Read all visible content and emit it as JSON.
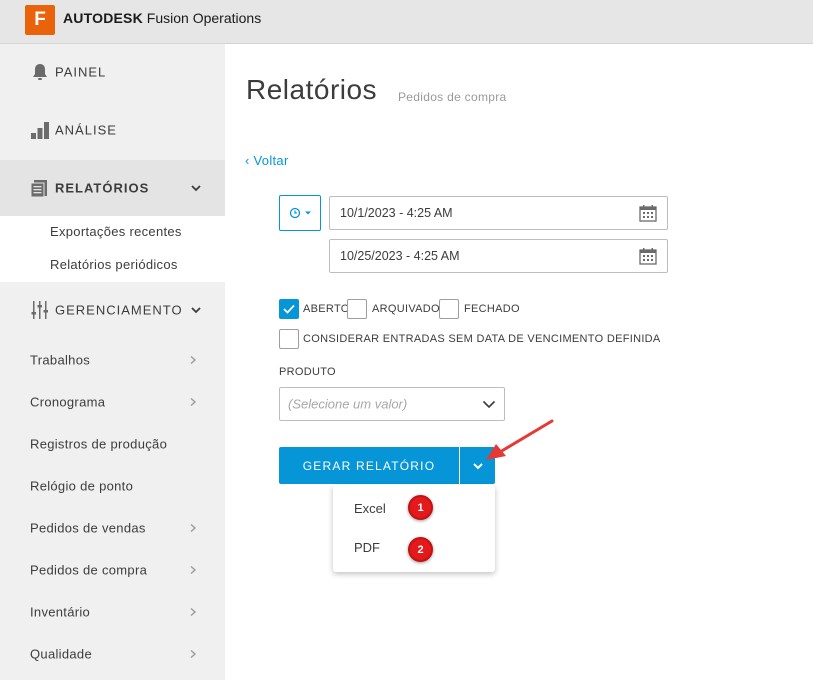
{
  "header": {
    "logo_letter": "F",
    "brand_bold": "AUTODESK",
    "brand_rest": " Fusion Operations",
    "logo_color": "#e8630a"
  },
  "sidebar": {
    "painel": {
      "label": "PAINEL",
      "icon": "bell-icon"
    },
    "analise": {
      "label": "ANÁLISE",
      "icon": "bar-chart-icon"
    },
    "relatorios": {
      "label": "RELATÓRIOS",
      "icon": "document-stack-icon"
    },
    "relatorios_sub": [
      "Exportações recentes",
      "Relatórios periódicos"
    ],
    "gerenciamento": {
      "label": "GERENCIAMENTO",
      "icon": "sliders-icon"
    },
    "items": [
      {
        "label": "Trabalhos",
        "has_chevron": true
      },
      {
        "label": "Cronograma",
        "has_chevron": true
      },
      {
        "label": "Registros de produção",
        "has_chevron": false
      },
      {
        "label": "Relógio de ponto",
        "has_chevron": false
      },
      {
        "label": "Pedidos de vendas",
        "has_chevron": true
      },
      {
        "label": "Pedidos de compra",
        "has_chevron": true
      },
      {
        "label": "Inventário",
        "has_chevron": true
      },
      {
        "label": "Qualidade",
        "has_chevron": true
      }
    ]
  },
  "main": {
    "title": "Relatórios",
    "subtitle": "Pedidos de compra",
    "back_label": "‹ Voltar",
    "date_from": "10/1/2023 - 4:25 AM",
    "date_to": "10/25/2023 - 4:25 AM",
    "status_filters": [
      {
        "label": "ABERTO",
        "checked": true
      },
      {
        "label": "ARQUIVADO",
        "checked": false
      },
      {
        "label": "FECHADO",
        "checked": false
      }
    ],
    "no_due_date_label": "CONSIDERAR ENTRADAS SEM DATA DE VENCIMENTO DEFINIDA",
    "no_due_date_checked": false,
    "product_label": "PRODUTO",
    "product_placeholder": "(Selecione um valor)",
    "generate_label": "GERAR RELATÓRIO",
    "export_options": [
      "Excel",
      "PDF"
    ],
    "badges": [
      "1",
      "2"
    ],
    "accent_color": "#0696d7",
    "badge_color": "#e3191b"
  }
}
